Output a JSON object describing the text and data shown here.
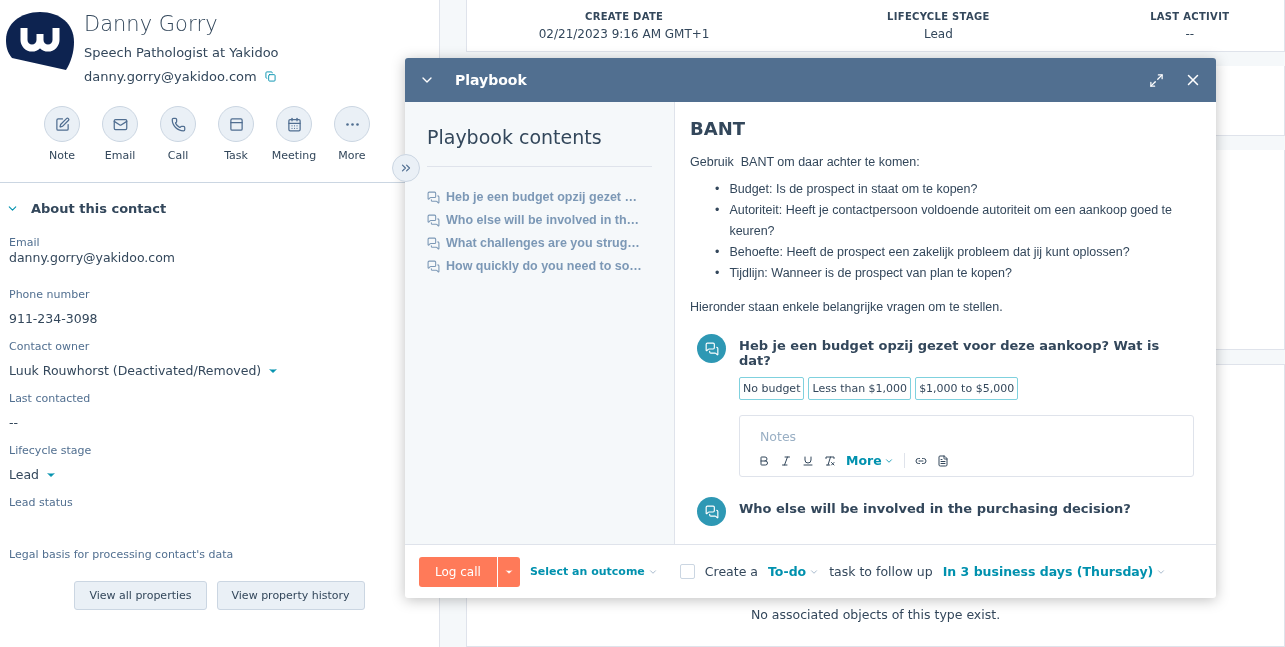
{
  "contact": {
    "name": "Danny Gorry",
    "title": "Speech Pathologist at Yakidoo",
    "email": "danny.gorry@yakidoo.com"
  },
  "actions": [
    {
      "kind": "note",
      "label": "Note"
    },
    {
      "kind": "email",
      "label": "Email"
    },
    {
      "kind": "call",
      "label": "Call"
    },
    {
      "kind": "task",
      "label": "Task"
    },
    {
      "kind": "meeting",
      "label": "Meeting"
    },
    {
      "kind": "more",
      "label": "More"
    }
  ],
  "about": {
    "title": "About this contact",
    "expanded": true,
    "properties": [
      {
        "label": "Email",
        "value": "danny.gorry@yakidoo.com",
        "dropdown": false
      },
      {
        "label": "Phone number",
        "value": "911-234-3098",
        "dropdown": false
      },
      {
        "label": "Contact owner",
        "value": "Luuk Rouwhorst (Deactivated/Removed)",
        "dropdown": true
      },
      {
        "label": "Last contacted",
        "value": "--",
        "dropdown": false
      },
      {
        "label": "Lifecycle stage",
        "value": "Lead",
        "dropdown": true
      },
      {
        "label": "Lead status"
      },
      {
        "label": "Legal basis for processing contact's data"
      }
    ],
    "buttons": [
      "View all properties",
      "View property history"
    ]
  },
  "summary": {
    "columns": [
      {
        "heading": "CREATE DATE",
        "value": "02/21/2023 9:16 AM GMT+1"
      },
      {
        "heading": "LIFECYCLE STAGE",
        "value": "Lead"
      },
      {
        "heading": "LAST ACTIVIT",
        "value": "--"
      }
    ]
  },
  "empty_message": "No associated objects of this type exist.",
  "playbook": {
    "title": "Playbook",
    "contents_title": "Playbook contents",
    "contents": [
      "Heb je een budget opzij gezet …",
      "Who else will be involved in th…",
      "What challenges are you strug…",
      "How quickly do you need to so…"
    ],
    "heading": "BANT",
    "marker": "•",
    "intro": "Gebruik  BANT om daar achter te komen:",
    "bullets": [
      "Budget: Is de prospect in staat om te kopen?",
      "Autoriteit: Heeft je contactpersoon voldoende autoriteit om een aankoop goed te keuren?",
      "Behoefte: Heeft de prospect een zakelijk probleem dat jij kunt oplossen?",
      "Tijdlijn: Wanneer is de prospect van plan te kopen?"
    ],
    "outro": "Hieronder staan enkele belangrijke vragen om te stellen.",
    "questions": [
      {
        "text": "Heb je een budget opzij gezet voor deze aankoop? Wat is dat?",
        "options": [
          "No budget",
          "Less than $1,000",
          "$1,000 to $5,000"
        ],
        "notes_placeholder": "Notes",
        "more": "More"
      },
      {
        "text": "Who else will be involved in the purchasing decision?"
      }
    ],
    "footer": {
      "log_call": "Log call",
      "outcome": "Select an outcome",
      "checked": false,
      "create": "Create a",
      "task_type": "To-do",
      "follow": "task to follow up",
      "due": "In 3 business days (Thursday)"
    }
  }
}
